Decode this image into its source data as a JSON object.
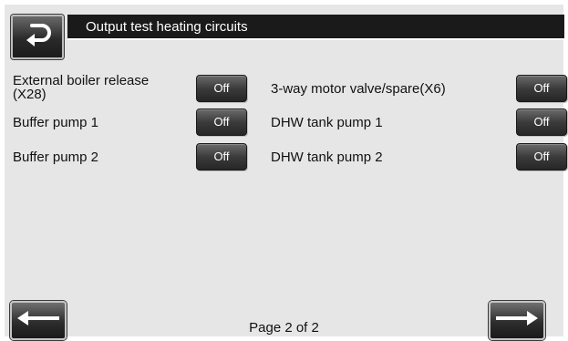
{
  "header": {
    "title": "Output test heating circuits",
    "back_icon": "return-arrow-icon"
  },
  "outputs_left": [
    {
      "label_line1": "External boiler release",
      "label_line2": "(X28)",
      "state": "Off"
    },
    {
      "label": "Buffer pump 1",
      "state": "Off"
    },
    {
      "label": "Buffer pump 2",
      "state": "Off"
    }
  ],
  "outputs_right": [
    {
      "label": "3-way motor valve/spare(X6)",
      "state": "Off"
    },
    {
      "label": "DHW tank pump 1",
      "state": "Off"
    },
    {
      "label": "DHW tank pump 2",
      "state": "Off"
    }
  ],
  "footer": {
    "page_label": "Page 2 of 2",
    "prev_icon": "arrow-left-icon",
    "next_icon": "arrow-right-icon"
  }
}
